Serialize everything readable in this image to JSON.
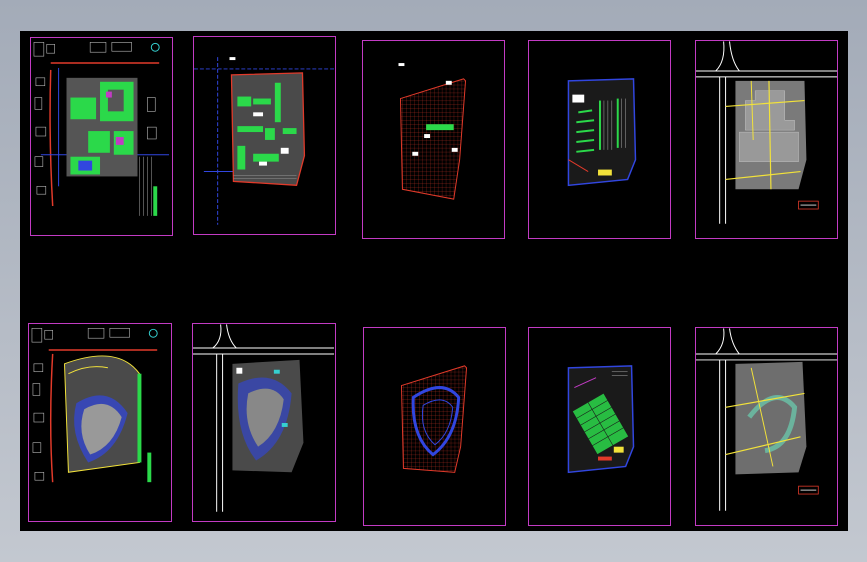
{
  "window": {
    "title": ""
  },
  "colors": {
    "background": "#000000",
    "frame": "#c23bc4",
    "green": "#2bd94a",
    "red": "#e23a2a",
    "blue": "#3146e0",
    "yellow": "#f2e23a",
    "white": "#ffffff",
    "gray": "#8a8a8a",
    "cyan": "#35d0d0"
  },
  "sheets": [
    {
      "id": "sheet-1",
      "row": 1,
      "kind": "master-plan-green"
    },
    {
      "id": "sheet-2",
      "row": 1,
      "kind": "site-plan-blue-axes"
    },
    {
      "id": "sheet-3",
      "row": 1,
      "kind": "grid-paving-red"
    },
    {
      "id": "sheet-4",
      "row": 1,
      "kind": "parking-layout-blue"
    },
    {
      "id": "sheet-5",
      "row": 1,
      "kind": "road-plan-gray"
    },
    {
      "id": "sheet-6",
      "row": 2,
      "kind": "master-plan-curved"
    },
    {
      "id": "sheet-7",
      "row": 2,
      "kind": "site-plan-curved"
    },
    {
      "id": "sheet-8",
      "row": 2,
      "kind": "grid-paving-curved"
    },
    {
      "id": "sheet-9",
      "row": 2,
      "kind": "parking-layout-curved"
    },
    {
      "id": "sheet-10",
      "row": 2,
      "kind": "road-plan-curved"
    }
  ]
}
